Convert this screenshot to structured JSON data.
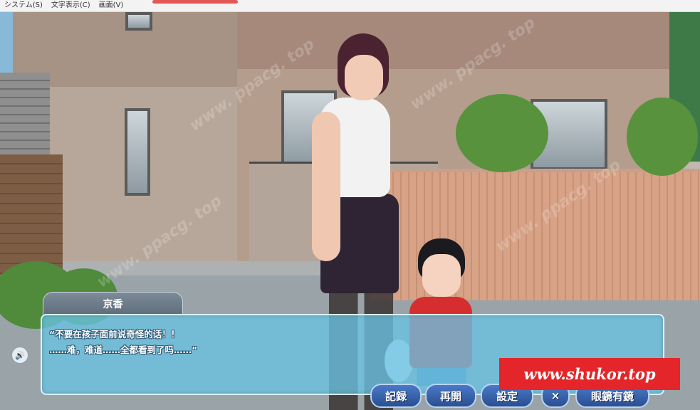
{
  "menubar": {
    "items": [
      "システム(S)",
      "文字表示(C)",
      "画面(V)"
    ]
  },
  "dialog": {
    "speaker": "京香",
    "line1": "“不要在孩子面前说奇怪的话！！",
    "line2": "……难，难道……全都看到了吗……”"
  },
  "controls": {
    "log": "記録",
    "restart": "再開",
    "settings": "設定",
    "close": "×",
    "glasses": "眼鏡有鏡"
  },
  "watermark": {
    "banner": "www.shukor.top",
    "overlay": "www. ppacg. top"
  },
  "colors": {
    "dialog_bg": "#69c3e1",
    "button_bg": "#2a4f91",
    "banner_bg": "#e4262a"
  },
  "icons": {
    "voice": "speaker-icon"
  }
}
